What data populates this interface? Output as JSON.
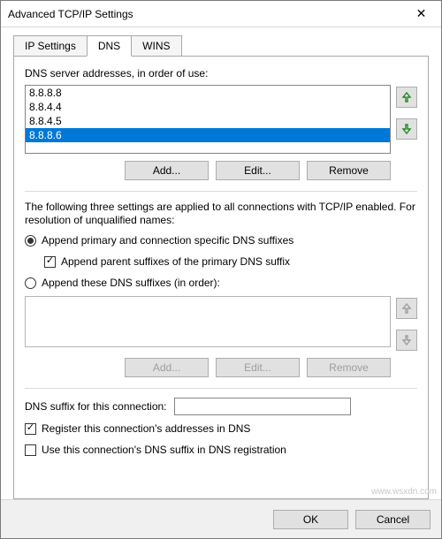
{
  "window": {
    "title": "Advanced TCP/IP Settings",
    "close_label": "✕"
  },
  "tabs": {
    "ip": "IP Settings",
    "dns": "DNS",
    "wins": "WINS"
  },
  "dns": {
    "servers_label": "DNS server addresses, in order of use:",
    "servers": [
      "8.8.8.8",
      "8.8.4.4",
      "8.8.4.5",
      "8.8.8.6"
    ],
    "selected_index": 3,
    "add": "Add...",
    "edit": "Edit...",
    "remove": "Remove",
    "desc": "The following three settings are applied to all connections with TCP/IP enabled. For resolution of unqualified names:",
    "r1": "Append primary and connection specific DNS suffixes",
    "r1c": "Append parent suffixes of the primary DNS suffix",
    "r2": "Append these DNS suffixes (in order):",
    "suffix_label": "DNS suffix for this connection:",
    "reg": "Register this connection's addresses in DNS",
    "usereg": "Use this connection's DNS suffix in DNS registration"
  },
  "buttons": {
    "ok": "OK",
    "cancel": "Cancel"
  },
  "watermark": "www.wsxdn.com"
}
